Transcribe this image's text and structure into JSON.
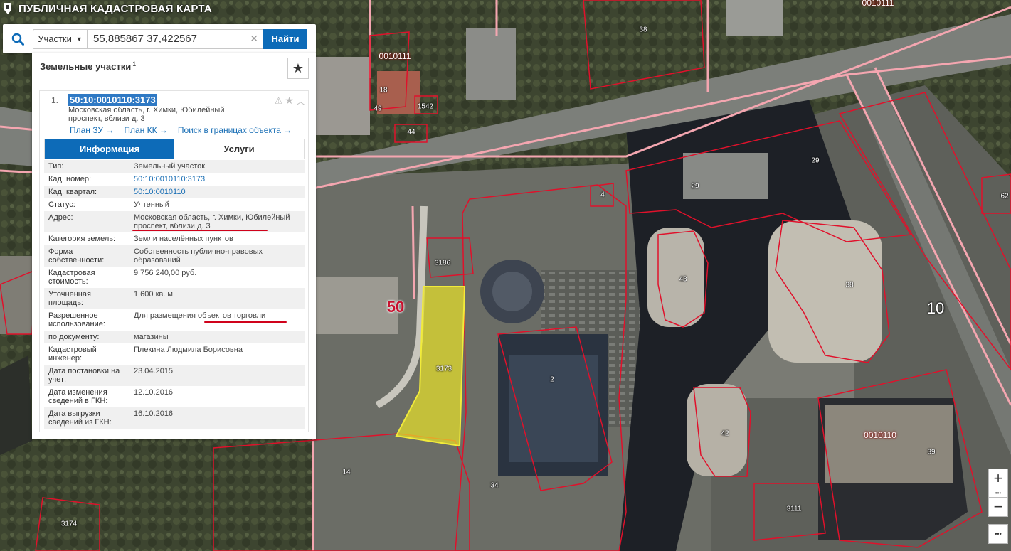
{
  "app": {
    "title": "ПУБЛИЧНАЯ КАДАСТРОВАЯ КАРТА",
    "logo_icon": "map-marker-icon"
  },
  "search": {
    "type_label": "Участки",
    "query": "55,885867 37,422567",
    "button_label": "Найти"
  },
  "panel": {
    "title": "Земельные участки",
    "count_sup": "1",
    "result": {
      "index": "1.",
      "cadastral_number": "50:10:0010110:3173",
      "address": "Московская область, г. Химки, Юбилейный проспект, вблизи д. 3",
      "links": [
        "План ЗУ →",
        "План КК →",
        "Поиск в границах объекта →"
      ],
      "tabs": [
        "Информация",
        "Услуги"
      ],
      "active_tab": "Информация",
      "fields": [
        {
          "key": "Тип:",
          "value": "Земельный участок"
        },
        {
          "key": "Кад. номер:",
          "value": "50:10:0010110:3173",
          "link": true
        },
        {
          "key": "Кад. квартал:",
          "value": "50:10:0010110",
          "link": true
        },
        {
          "key": "Статус:",
          "value": "Учтенный"
        },
        {
          "key": "Адрес:",
          "value": "Московская область, г. Химки, Юбилейный проспект, вблизи д. 3"
        },
        {
          "key": "Категория земель:",
          "value": "Земли населённых пунктов"
        },
        {
          "key": "Форма собственности:",
          "value": "Собственность публично-правовых образований"
        },
        {
          "key": "Кадастровая стоимость:",
          "value": "9 756 240,00 руб."
        },
        {
          "key": "Уточненная площадь:",
          "value": "1 600 кв. м"
        },
        {
          "key": "Разрешенное использование:",
          "value": "Для размещения объектов торговли"
        },
        {
          "key": "по документу:",
          "value": "магазины"
        },
        {
          "key": "Кадастровый инженер:",
          "value": "Плекина Людмила Борисовна"
        },
        {
          "key": "Дата постановки на учет:",
          "value": "23.04.2015"
        },
        {
          "key": "Дата изменения сведений в ГКН:",
          "value": "12.10.2016"
        },
        {
          "key": "Дата выгрузки сведений из ГКН:",
          "value": "16.10.2016"
        }
      ]
    }
  },
  "map": {
    "labels": [
      {
        "text": "0010111",
        "kind": "quarter"
      },
      {
        "text": "0010111",
        "kind": "quarter"
      },
      {
        "text": "38",
        "kind": "parcel"
      },
      {
        "text": "49",
        "kind": "parcel"
      },
      {
        "text": "18",
        "kind": "parcel"
      },
      {
        "text": "1542",
        "kind": "parcel"
      },
      {
        "text": "44",
        "kind": "parcel"
      },
      {
        "text": "29",
        "kind": "parcel"
      },
      {
        "text": "29",
        "kind": "parcel"
      },
      {
        "text": "62",
        "kind": "parcel"
      },
      {
        "text": "3186",
        "kind": "parcel"
      },
      {
        "text": "43",
        "kind": "parcel"
      },
      {
        "text": "38",
        "kind": "parcel"
      },
      {
        "text": "50",
        "kind": "district"
      },
      {
        "text": "10",
        "kind": "district"
      },
      {
        "text": "3173",
        "kind": "selected"
      },
      {
        "text": "2",
        "kind": "parcel"
      },
      {
        "text": "42",
        "kind": "parcel"
      },
      {
        "text": "0010110",
        "kind": "quarter"
      },
      {
        "text": "39",
        "kind": "parcel"
      },
      {
        "text": "14",
        "kind": "parcel"
      },
      {
        "text": "34",
        "kind": "parcel"
      },
      {
        "text": "3111",
        "kind": "parcel"
      },
      {
        "text": "3174",
        "kind": "parcel"
      },
      {
        "text": "4",
        "kind": "parcel"
      }
    ],
    "colors": {
      "selected_fill": "#e6e12a",
      "boundary": "#e0112b",
      "quarter_line": "#f4a6b0"
    }
  },
  "controls": {
    "zoom_in": "+",
    "zoom_out": "−",
    "more": "•••"
  }
}
